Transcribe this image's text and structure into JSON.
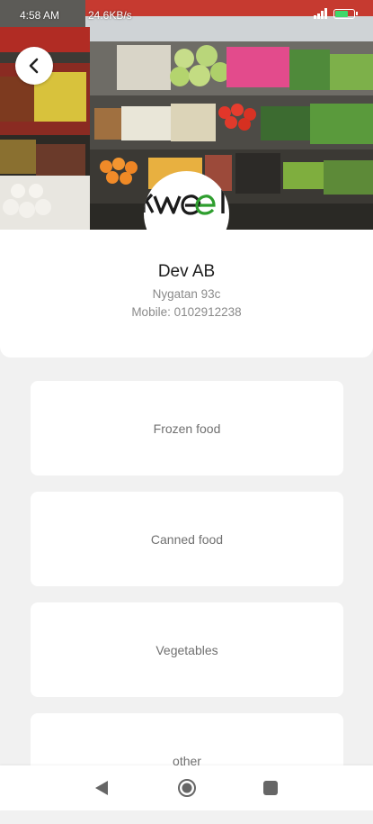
{
  "status_bar": {
    "time": "4:58 AM",
    "net_speed": "24.6KB/s"
  },
  "hero": {
    "back_icon": "chevron-left-icon",
    "logo_text": "kweel",
    "logo_accent_color": "#2e9e2e"
  },
  "store": {
    "name": "Dev AB",
    "address": "Nygatan 93c",
    "mobile": "Mobile: 0102912238"
  },
  "categories": [
    {
      "label": "Frozen food"
    },
    {
      "label": "Canned food"
    },
    {
      "label": "Vegetables"
    },
    {
      "label": "other"
    }
  ],
  "nav": {
    "back_icon": "triangle-back-icon",
    "home_icon": "circle-home-icon",
    "recents_icon": "square-recents-icon"
  }
}
